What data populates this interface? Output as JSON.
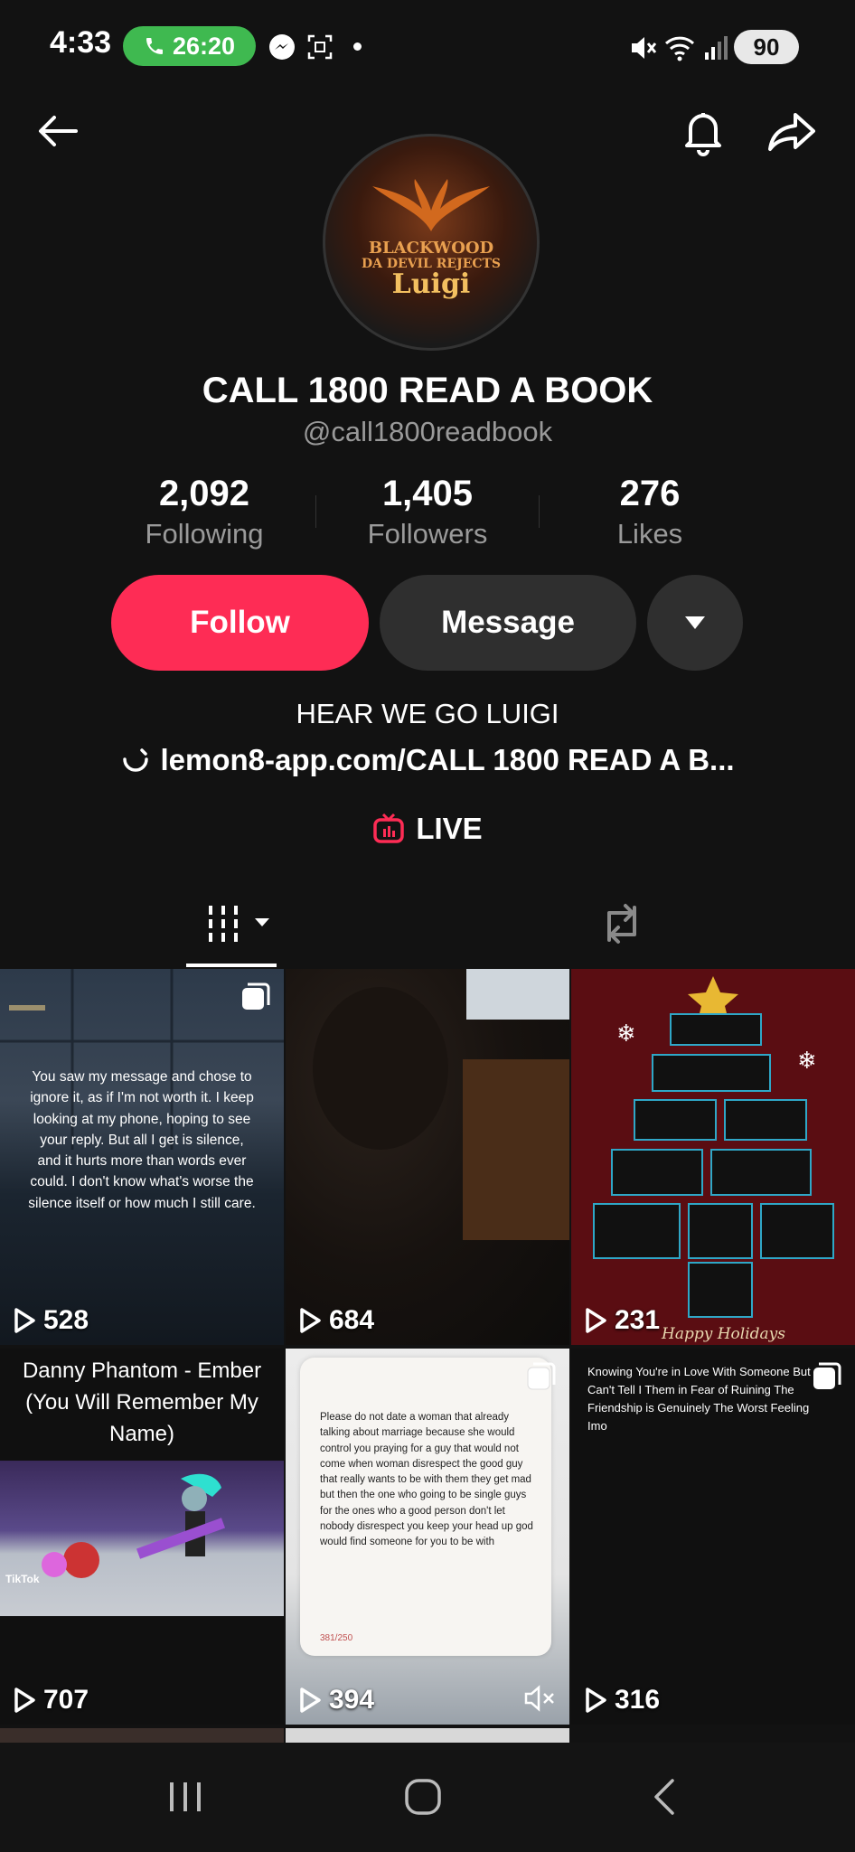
{
  "status_bar": {
    "time": "4:33",
    "call_timer": "26:20",
    "battery": "90"
  },
  "profile": {
    "display_name": "CALL 1800 READ A BOOK",
    "username": "@call1800readbook",
    "avatar_text": {
      "line1": "BLACKWOOD",
      "line2": "DA DEVIL REJECTS",
      "line3": "Luigi"
    },
    "stats": [
      {
        "value": "2,092",
        "label": "Following"
      },
      {
        "value": "1,405",
        "label": "Followers"
      },
      {
        "value": "276",
        "label": "Likes"
      }
    ],
    "bio": "HEAR WE GO LUIGI",
    "link": "lemon8-app.com/CALL 1800 READ A B...",
    "live_label": "LIVE"
  },
  "actions": {
    "follow_label": "Follow",
    "message_label": "Message"
  },
  "tabs": [
    {
      "icon": "videos-grid-icon",
      "active": true
    },
    {
      "icon": "repost-icon",
      "active": false
    }
  ],
  "videos": [
    {
      "views": "528",
      "caption": "You saw my message and chose to ignore it, as if I'm not worth it. I keep looking at my phone, hoping to see your reply. But all I get is silence, and it hurts more than words ever could. I don't know what's worse the silence itself or how much I still care."
    },
    {
      "views": "684",
      "caption": ""
    },
    {
      "views": "231",
      "caption": "Happy Holidays"
    },
    {
      "views": "707",
      "caption": "Danny Phantom - Ember (You Will Remember My Name)",
      "watermark": "TikTok"
    },
    {
      "views": "394",
      "caption": "Please do not date a woman that already talking about marriage because she would control you praying for a guy that would not come when woman disrespect the good guy that really wants to be with them they get mad but then the one who going to be single guys for the ones who a good person don't let nobody disrespect you keep your head up god would find someone for you to be with",
      "counter": "381/250"
    },
    {
      "views": "316",
      "caption": "Knowing You're in Love With Someone But Can't Tell I Them in Fear of Ruining The Friendship is Genuinely The Worst Feeling Imo"
    }
  ],
  "colors": {
    "background": "#121212",
    "follow": "#fe2c55",
    "secondary_button": "#2f2f2f",
    "call_pill": "#3fb950",
    "live_icon": "#fe2c55"
  }
}
